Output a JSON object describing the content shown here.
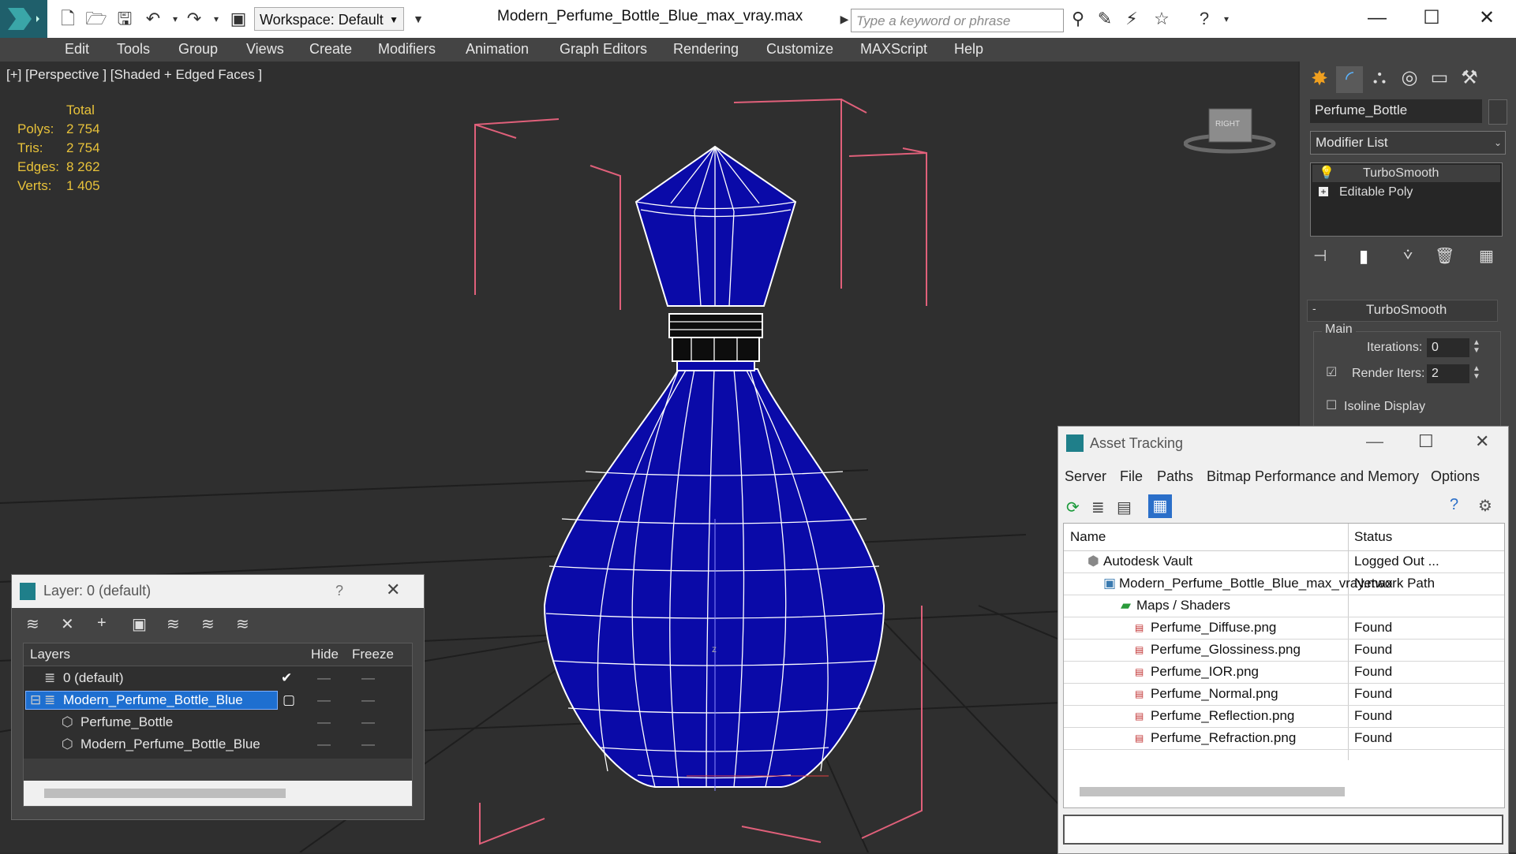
{
  "app": {
    "workspace": "Workspace: Default",
    "file_title": "Modern_Perfume_Bottle_Blue_max_vray.max",
    "search_placeholder": "Type a keyword or phrase"
  },
  "menu": [
    "Edit",
    "Tools",
    "Group",
    "Views",
    "Create",
    "Modifiers",
    "Animation",
    "Graph Editors",
    "Rendering",
    "Customize",
    "MAXScript",
    "Help"
  ],
  "viewport": {
    "label": "[+] [Perspective ] [Shaded + Edged Faces ]",
    "stats_header": "Total",
    "stats": [
      {
        "label": "Polys:",
        "value": "2 754"
      },
      {
        "label": "Tris:",
        "value": "2 754"
      },
      {
        "label": "Edges:",
        "value": "8 262"
      },
      {
        "label": "Verts:",
        "value": "1 405"
      }
    ],
    "viewcube_label": "RIGHT",
    "axis_label": "z"
  },
  "command_panel": {
    "object_name": "Perfume_Bottle",
    "modifier_list": "Modifier List",
    "stack": [
      "TurboSmooth",
      "Editable Poly"
    ],
    "rollout_title": "TurboSmooth",
    "group_label": "Main",
    "iterations_label": "Iterations:",
    "iterations_value": "0",
    "render_iters_label": "Render Iters:",
    "render_iters_value": "2",
    "isoline_label": "Isoline Display"
  },
  "asset_tracking": {
    "title": "Asset Tracking",
    "menu": [
      "Server",
      "File",
      "Paths",
      "Bitmap Performance and Memory",
      "Options"
    ],
    "col_name": "Name",
    "col_status": "Status",
    "rows": [
      {
        "name": "Autodesk Vault",
        "status": "Logged Out ..."
      },
      {
        "name": "Modern_Perfume_Bottle_Blue_max_vray.max",
        "status": "Network Path"
      },
      {
        "name": "Maps / Shaders",
        "status": ""
      },
      {
        "name": "Perfume_Diffuse.png",
        "status": "Found"
      },
      {
        "name": "Perfume_Glossiness.png",
        "status": "Found"
      },
      {
        "name": "Perfume_IOR.png",
        "status": "Found"
      },
      {
        "name": "Perfume_Normal.png",
        "status": "Found"
      },
      {
        "name": "Perfume_Reflection.png",
        "status": "Found"
      },
      {
        "name": "Perfume_Refraction.png",
        "status": "Found"
      }
    ]
  },
  "layer_dialog": {
    "title": "Layer: 0 (default)",
    "help": "?",
    "col_layers": "Layers",
    "col_hide": "Hide",
    "col_freeze": "Freeze",
    "rows": [
      {
        "name": "0 (default)"
      },
      {
        "name": "Modern_Perfume_Bottle_Blue"
      },
      {
        "name": "Perfume_Bottle"
      },
      {
        "name": "Modern_Perfume_Bottle_Blue"
      }
    ]
  },
  "colors": {
    "bottle_blue": "#0a0aa8",
    "selection_pink": "#e0607a",
    "stats_yellow": "#e8c23a",
    "layer_highlight": "#1e6fd0"
  }
}
